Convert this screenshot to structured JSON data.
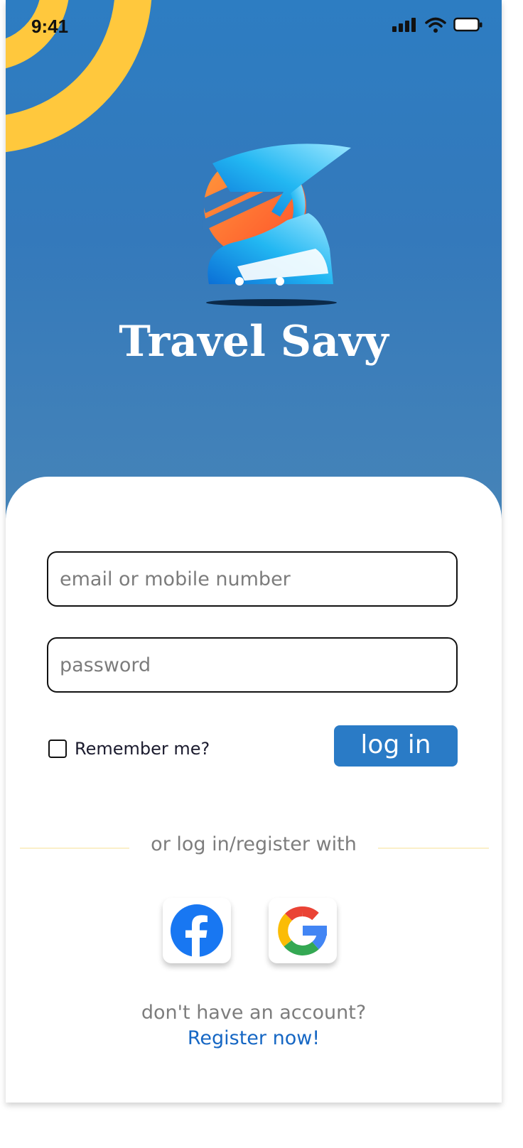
{
  "status_bar": {
    "time": "9:41",
    "icons": [
      "cellular-signal-icon",
      "wifi-icon",
      "battery-icon"
    ]
  },
  "app": {
    "name": "Travel Savy",
    "logo": "travel-savy-logo"
  },
  "form": {
    "email_placeholder": "email or mobile number",
    "password_placeholder": "password",
    "remember_label": "Remember me?",
    "login_label": "log in"
  },
  "social": {
    "divider_text": "or log in/register with",
    "providers": [
      "facebook-icon",
      "google-icon"
    ]
  },
  "register": {
    "prompt": "don't have an account?",
    "link_text": "Register now!"
  },
  "colors": {
    "primary": "#2a7bc6",
    "accent": "#ffc83d",
    "link": "#1667c4",
    "divider": "#fbefc9"
  }
}
